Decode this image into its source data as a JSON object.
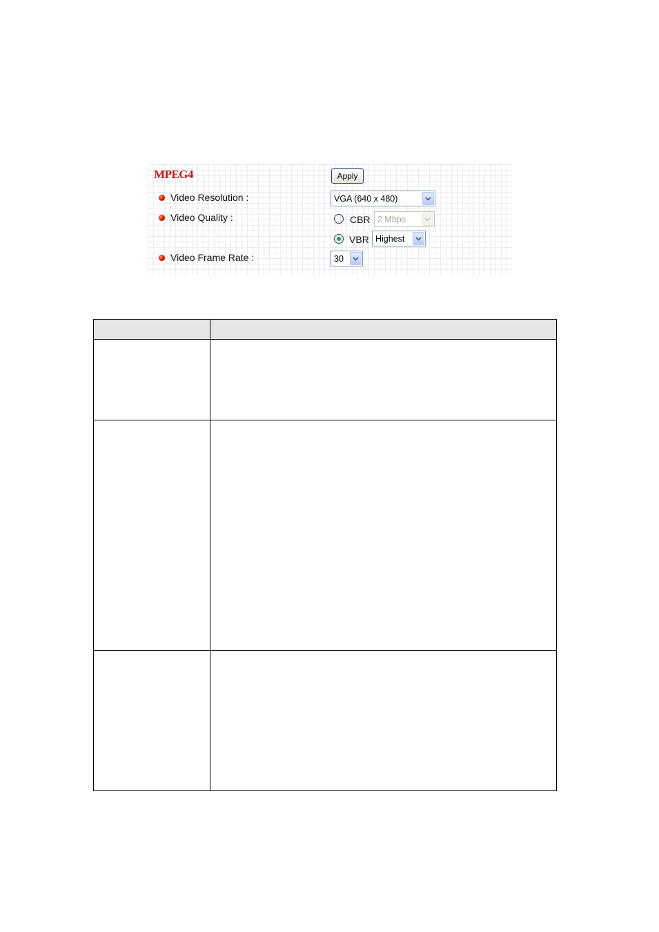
{
  "panel": {
    "title": "MPEG4",
    "apply_label": "Apply",
    "video_resolution": {
      "label": "Video Resolution :",
      "value": "VGA (640 x 480)"
    },
    "video_quality": {
      "label": "Video Quality :",
      "cbr": {
        "label": "CBR",
        "value": "2 Mbps",
        "selected": false,
        "enabled": false
      },
      "vbr": {
        "label": "VBR",
        "value": "Highest",
        "selected": true,
        "enabled": true
      }
    },
    "video_frame_rate": {
      "label": "Video Frame Rate :",
      "value": "30"
    },
    "colors": {
      "title": "#cc1111",
      "bullet": "#e81a00",
      "select_border": "#7f9db9",
      "radio_dot": "#26a03b"
    }
  },
  "table": {
    "header_color": "#e6e6e6",
    "columns": 2,
    "rows": 3
  }
}
